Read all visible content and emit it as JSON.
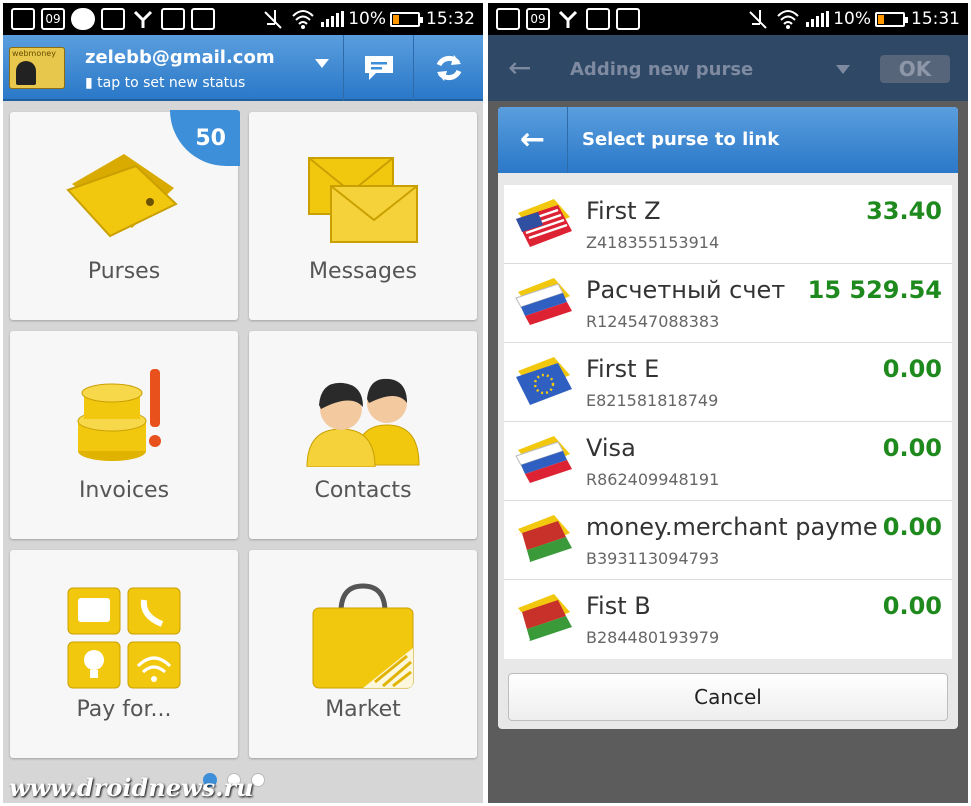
{
  "left": {
    "status": {
      "battery": "10%",
      "time": "15:32",
      "date_icon": "09"
    },
    "header": {
      "email": "zelebb@gmail.com",
      "status_hint": "tap to set new status"
    },
    "tiles": [
      {
        "label": "Purses",
        "badge": "50"
      },
      {
        "label": "Messages"
      },
      {
        "label": "Invoices"
      },
      {
        "label": "Contacts"
      },
      {
        "label": "Pay for..."
      },
      {
        "label": "Market"
      }
    ],
    "watermark": "www.droidnews.ru"
  },
  "right": {
    "status": {
      "battery": "10%",
      "time": "15:31",
      "date_icon": "09"
    },
    "header": {
      "title": "Adding new purse",
      "ok": "OK"
    },
    "dialog": {
      "title": "Select purse to link",
      "purses": [
        {
          "name": "First Z",
          "number": "Z418355153914",
          "amount": "33.40",
          "flag": "us"
        },
        {
          "name": "Расчетный счет",
          "number": "R124547088383",
          "amount": "15 529.54",
          "flag": "ru"
        },
        {
          "name": "First E",
          "number": "E821581818749",
          "amount": "0.00",
          "flag": "eu"
        },
        {
          "name": "Visa",
          "number": "R862409948191",
          "amount": "0.00",
          "flag": "ru"
        },
        {
          "name": "money.merchant payme",
          "number": "B393113094793",
          "amount": "0.00",
          "flag": "by"
        },
        {
          "name": "Fist B",
          "number": "B284480193979",
          "amount": "0.00",
          "flag": "by"
        }
      ],
      "cancel": "Cancel"
    }
  },
  "colors": {
    "accent": "#3d8fd9",
    "amount": "#1e8a1e",
    "gold": "#f2c80f"
  }
}
